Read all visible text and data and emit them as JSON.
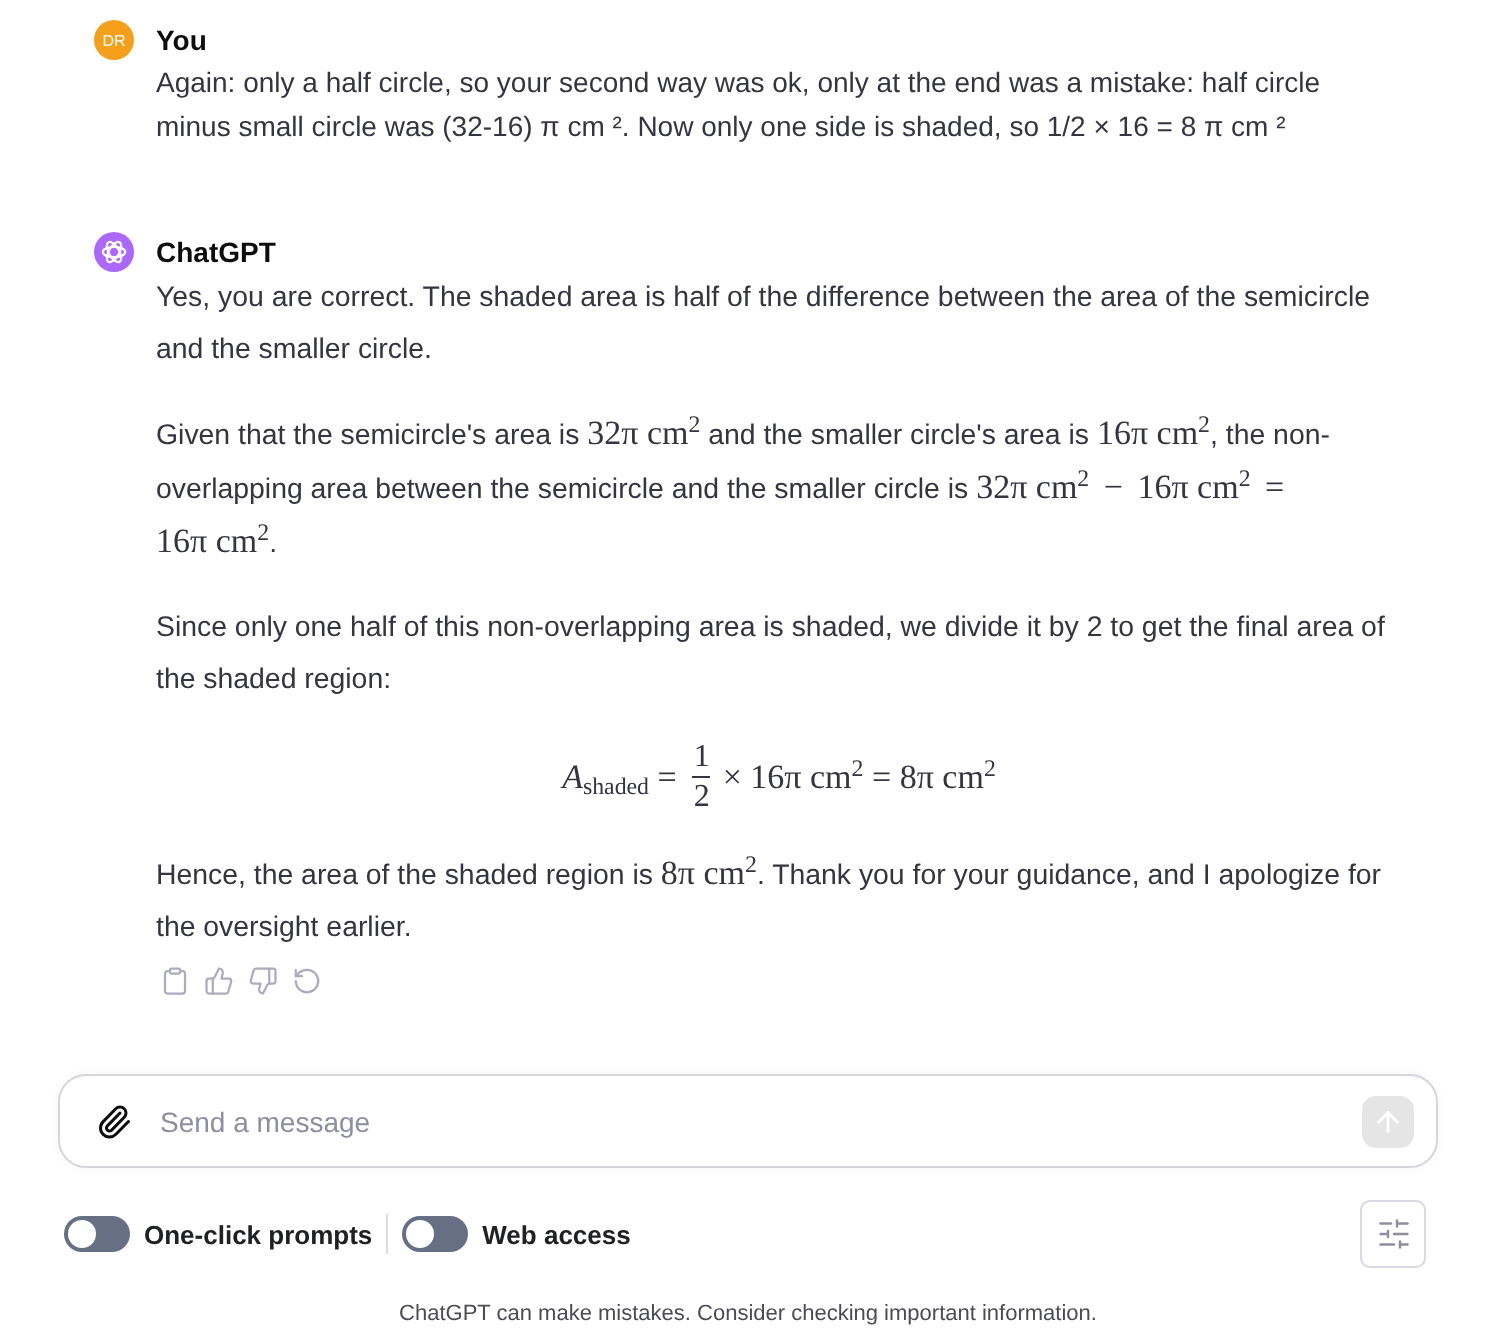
{
  "messages": [
    {
      "kind": "user",
      "avatar": "DR",
      "author": "You",
      "text": "Again: only a half circle, so your second way was ok, only at the end was a mistake: half circle minus small circle was (32-16) π cm ². Now only one side is shaded, so 1/2 × 16 = 8 π cm ²"
    },
    {
      "kind": "assistant",
      "author": "ChatGPT",
      "blocks": [
        {
          "kind": "paragraph",
          "segments": [
            {
              "kind": "text",
              "text": "Yes, you are correct. The shaded area is half of the difference between the area of the semicircle and the smaller circle."
            }
          ]
        },
        {
          "kind": "paragraph",
          "segments": [
            {
              "kind": "text",
              "text": "Given that the semicircle's area is "
            },
            {
              "kind": "math",
              "terms": [
                "32π cm$^{2}$"
              ]
            },
            {
              "kind": "text",
              "text": " and the smaller circle's area is "
            },
            {
              "kind": "math",
              "terms": [
                "16π cm$^{2}$"
              ]
            },
            {
              "kind": "text",
              "text": ", the non-overlapping area between the semicircle and the smaller circle is "
            },
            {
              "kind": "math",
              "terms": [
                "32π cm$^{2}$",
                "−",
                "16π cm$^{2}$",
                "=",
                "16π cm$^{2}$"
              ]
            },
            {
              "kind": "text",
              "text": "."
            }
          ]
        },
        {
          "kind": "paragraph",
          "segments": [
            {
              "kind": "text",
              "text": "Since only one half of this non-overlapping area is shaded, we divide it by 2 to get the final area of the shaded region:"
            }
          ]
        },
        {
          "kind": "equation",
          "lhs": "*A*$_{shaded}$ =",
          "numerator": "1",
          "denominator": "2",
          "rhs": "× 16π cm$^{2}$ = 8π cm$^{2}$"
        },
        {
          "kind": "paragraph",
          "segments": [
            {
              "kind": "text",
              "text": "Hence, the area of the shaded region is "
            },
            {
              "kind": "math",
              "terms": [
                "8π cm$^{2}$"
              ]
            },
            {
              "kind": "text",
              "text": ". Thank you for your guidance, and I apologize for the oversight earlier."
            }
          ]
        }
      ]
    }
  ],
  "composer": {
    "placeholder": "Send a message",
    "send_disabled": true
  },
  "toggles": [
    {
      "label": "One-click prompts",
      "on": false
    },
    {
      "label": "Web access",
      "on": false
    }
  ],
  "disclaimer": "ChatGPT can make mistakes. Consider checking important information."
}
